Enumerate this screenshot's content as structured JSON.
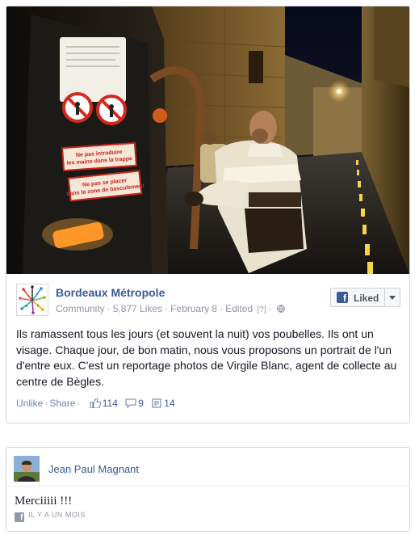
{
  "post": {
    "photo_alt": "Agent de collecte sur un camion poubelle la nuit",
    "warning_sign_1": "Ne pas introduire les mains dans la trappe",
    "warning_sign_2": "Ne pas se placer dans la zone de basculement",
    "page_name": "Bordeaux Métropole",
    "page_category": "Community",
    "likes": "5,877 Likes",
    "date": "February 8",
    "edited": "Edited",
    "help_marker": "[?]",
    "liked_label": "Liked",
    "text": "Ils ramassent tous les jours (et souvent la nuit) vos poubelles. Ils ont un visage. Chaque jour, de bon matin, nous vous proposons un portrait de l'un d'entre eux. C'est un reportage photos de Virgile Blanc, agent de collecte au centre de Bègles.",
    "actions": {
      "unlike": "Unlike",
      "share": "Share",
      "likes_count": "114",
      "comments_count": "9",
      "shares_count": "14"
    }
  },
  "comment": {
    "author": "Jean Paul Magnant",
    "text": "Merciiiii !!!",
    "time": "IL Y A UN MOIS"
  },
  "colors": {
    "facebook_blue": "#3b5998",
    "link_blue": "#6d84b4",
    "meta_gray": "#9197a3",
    "border": "#d3d6db"
  }
}
